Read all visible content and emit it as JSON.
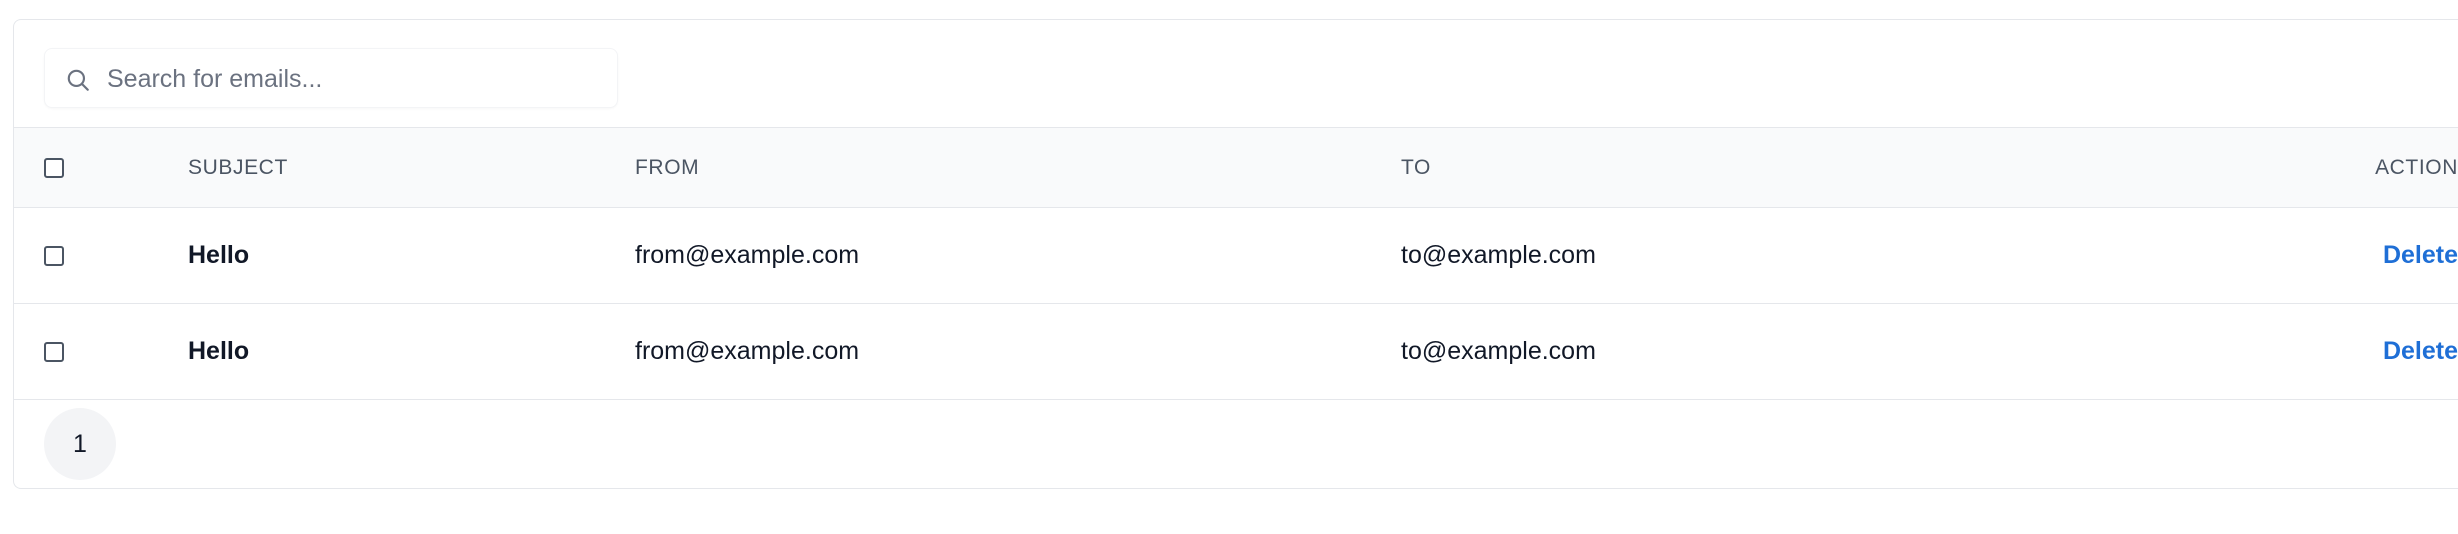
{
  "search": {
    "placeholder": "Search for emails...",
    "value": "",
    "icon": "search-icon"
  },
  "table": {
    "columns": {
      "subject": "SUBJECT",
      "from": "FROM",
      "to": "TO",
      "action": "ACTION"
    },
    "rows": [
      {
        "subject": "Hello",
        "from": "from@example.com",
        "to": "to@example.com",
        "action": "Delete",
        "checked": false
      },
      {
        "subject": "Hello",
        "from": "from@example.com",
        "to": "to@example.com",
        "action": "Delete",
        "checked": false
      }
    ]
  },
  "pagination": {
    "pages": [
      "1"
    ],
    "current": "1"
  },
  "colors": {
    "link": "#1f6fd6",
    "header_bg": "#f9fafb",
    "border": "#e5e7eb"
  }
}
